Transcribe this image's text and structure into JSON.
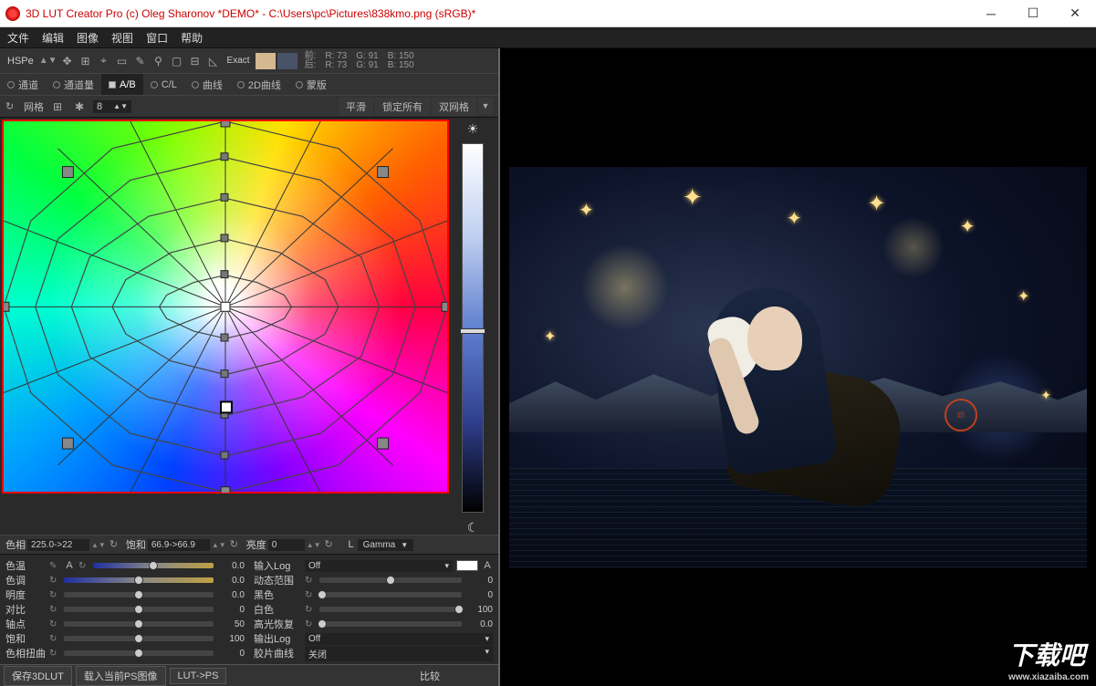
{
  "window": {
    "title": "3D LUT Creator Pro (c) Oleg Sharonov *DEMO* - C:\\Users\\pc\\Pictures\\838kmo.png (sRGB)*"
  },
  "menu": [
    "文件",
    "编辑",
    "图像",
    "视图",
    "窗口",
    "帮助"
  ],
  "toolbar": {
    "mode": "HSPe",
    "exact": "Exact",
    "rgb_before": {
      "label": "前:",
      "r": "R: 73",
      "g": "G: 91",
      "b": "B: 150"
    },
    "rgb_after": {
      "label": "后:",
      "r": "R: 73",
      "g": "G: 91",
      "b": "B: 150"
    }
  },
  "tabs": {
    "channel": "通道",
    "channel_amt": "通道量",
    "ab": "A/B",
    "cl": "C/L",
    "curves": "曲线",
    "curves2d": "2D曲线",
    "mask": "蒙版"
  },
  "gridbar": {
    "grid": "网格",
    "value": "8",
    "smooth": "平滑",
    "lockall": "锁定所有",
    "dual": "双网格"
  },
  "status": {
    "hue_label": "色相",
    "hue_val": "225.0->22",
    "sat_label": "饱和",
    "sat_val": "66.9->66.9",
    "lum_label": "亮度",
    "lum_val": "0",
    "l": "L",
    "gamma": "Gamma"
  },
  "sliders_left": [
    {
      "label": "色温",
      "val": "0.0",
      "pos": 50,
      "eye": true,
      "letter": "A",
      "track": "blue"
    },
    {
      "label": "色调",
      "val": "0.0",
      "pos": 50,
      "track": "blue"
    },
    {
      "label": "明度",
      "val": "0.0",
      "pos": 50
    },
    {
      "label": "对比",
      "val": "0",
      "pos": 50
    },
    {
      "label": "轴点",
      "val": "50",
      "pos": 50
    },
    {
      "label": "饱和",
      "val": "100",
      "pos": 50
    },
    {
      "label": "色相扭曲",
      "val": "0",
      "pos": 50
    }
  ],
  "sliders_right": [
    {
      "label": "输入Log",
      "type": "drop",
      "dval": "Off",
      "swatch": true,
      "letter": "A"
    },
    {
      "label": "动态范围",
      "val": "0",
      "pos": 50
    },
    {
      "label": "黑色",
      "val": "0",
      "pos": 2
    },
    {
      "label": "白色",
      "val": "100",
      "pos": 98
    },
    {
      "label": "高光恢复",
      "val": "0.0",
      "pos": 2
    },
    {
      "label": "输出Log",
      "type": "drop",
      "dval": "Off"
    },
    {
      "label": "胶片曲线",
      "type": "drop",
      "dval": "关闭"
    }
  ],
  "bottom": {
    "save": "保存3DLUT",
    "load": "载入当前PS图像",
    "lutps": "LUT->PS",
    "compare": "比较"
  },
  "watermark": {
    "main": "下载吧",
    "sub": "www.xiazaiba.com"
  }
}
